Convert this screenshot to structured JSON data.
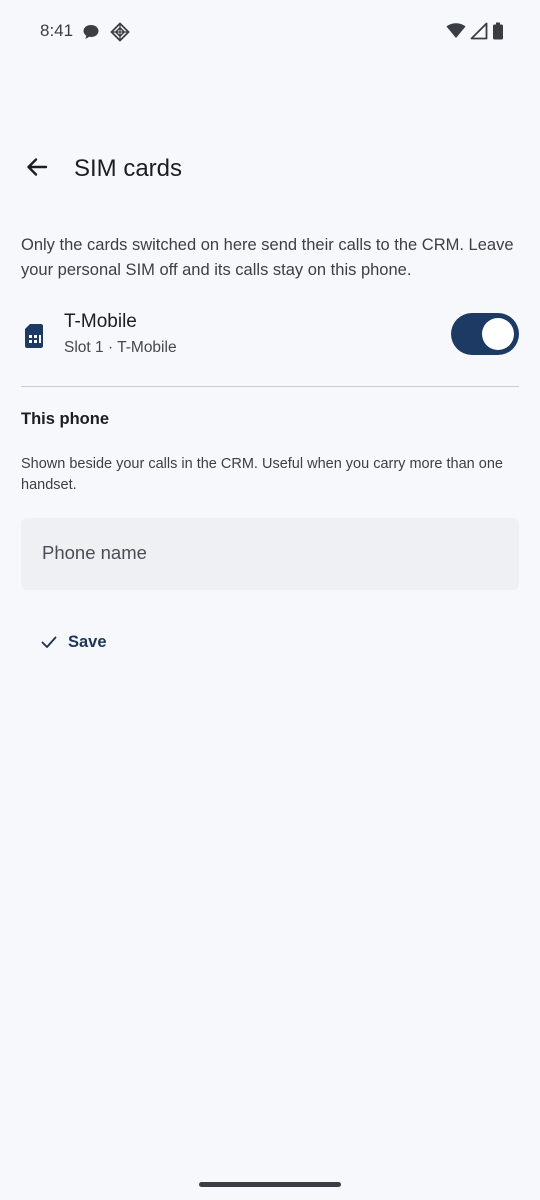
{
  "status_bar": {
    "time": "8:41",
    "left_icons": [
      "chat-bubble-icon",
      "diamond-grid-icon"
    ],
    "right_icons": [
      "wifi-icon",
      "cell-signal-icon",
      "battery-icon"
    ]
  },
  "header": {
    "back_icon": "arrow-back-icon",
    "title": "SIM cards"
  },
  "description": "Only the cards switched on here send their calls to the CRM. Leave your personal SIM off and its calls stay on this phone.",
  "sims": [
    {
      "icon": "sim-card-icon",
      "name": "T-Mobile",
      "detail": "Slot 1 · T-Mobile",
      "enabled": true
    }
  ],
  "this_phone": {
    "title": "This phone",
    "help": "Shown beside your calls in the CRM. Useful when you carry more than one handset.",
    "field_placeholder": "Phone name",
    "field_value": ""
  },
  "actions": {
    "save_icon": "check-icon",
    "save_label": "Save"
  },
  "colors": {
    "background": "#f6f8fb",
    "accent": "#1c3a63",
    "field_background": "#eef0f4"
  }
}
